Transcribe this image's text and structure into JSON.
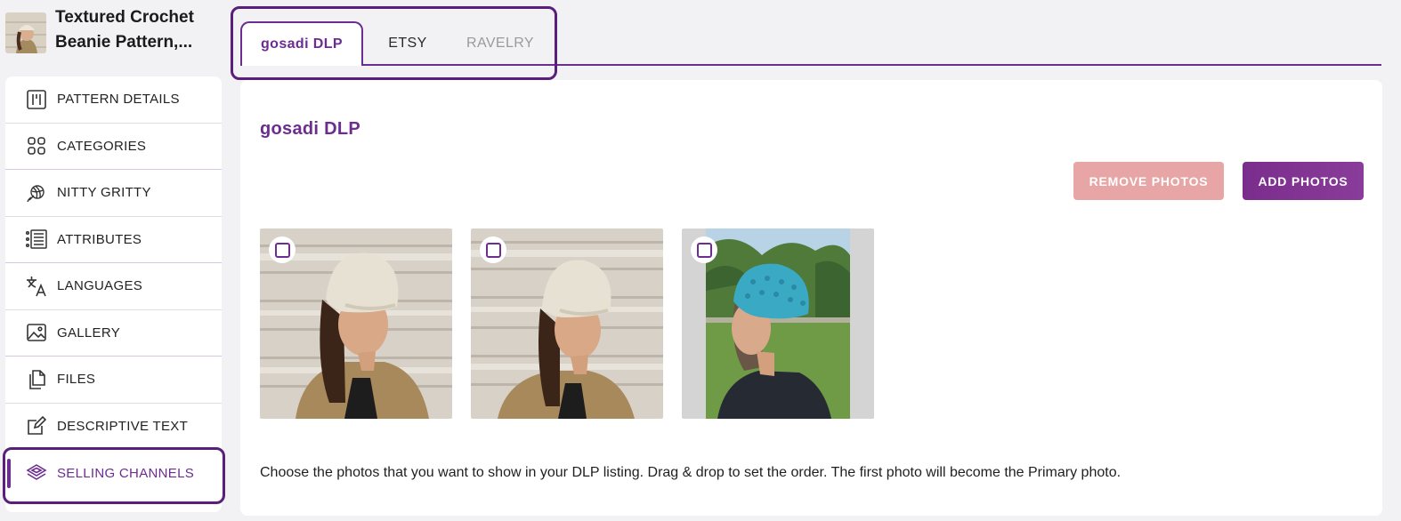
{
  "pattern": {
    "title_line1": "Textured Crochet",
    "title_line2": "Beanie Pattern,..."
  },
  "tabs": [
    {
      "label": "gosadi DLP",
      "active": true
    },
    {
      "label": "ETSY",
      "active": false
    },
    {
      "label": "RAVELRY",
      "active": false
    }
  ],
  "sidebar": {
    "items": [
      {
        "label": "PATTERN DETAILS",
        "icon": "pattern-details-icon"
      },
      {
        "label": "CATEGORIES",
        "icon": "categories-icon"
      },
      {
        "label": "NITTY GRITTY",
        "icon": "yarn-ball-icon"
      },
      {
        "label": "ATTRIBUTES",
        "icon": "attributes-icon"
      },
      {
        "label": "LANGUAGES",
        "icon": "translate-icon"
      },
      {
        "label": "GALLERY",
        "icon": "gallery-icon"
      },
      {
        "label": "FILES",
        "icon": "files-icon"
      },
      {
        "label": "DESCRIPTIVE TEXT",
        "icon": "edit-text-icon"
      },
      {
        "label": "SELLING CHANNELS",
        "icon": "layers-icon",
        "active": true
      }
    ]
  },
  "main": {
    "section_title": "gosadi DLP",
    "remove_button": "REMOVE PHOTOS",
    "add_button": "ADD PHOTOS",
    "photos": [
      {
        "hat_color": "#e6e1d2",
        "background": "wood"
      },
      {
        "hat_color": "#e6e1d2",
        "background": "wood"
      },
      {
        "hat_color": "#3aa9c4",
        "background": "outdoor"
      }
    ],
    "instructions": "Choose the photos that you want to show in your DLP listing. Drag & drop to set the order. The first photo will become the Primary photo."
  },
  "colors": {
    "accent": "#6b2d8f",
    "remove_button": "#e8a5a5"
  }
}
